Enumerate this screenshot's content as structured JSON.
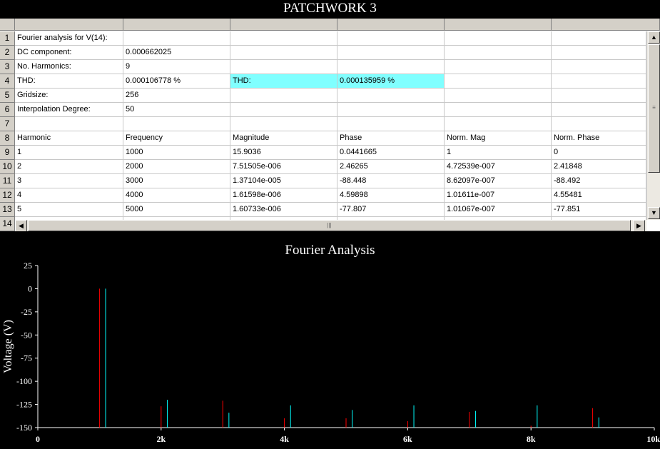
{
  "page_title": "PATCHWORK 3",
  "spreadsheet": {
    "row_numbers": [
      "1",
      "2",
      "3",
      "4",
      "5",
      "6",
      "7",
      "8",
      "9",
      "10",
      "11",
      "12",
      "13",
      "14"
    ],
    "rows": [
      [
        "Fourier analysis for V(14):",
        "",
        "",
        "",
        "",
        ""
      ],
      [
        "DC component:",
        "0.000662025",
        "",
        "",
        "",
        ""
      ],
      [
        "No. Harmonics:",
        "9",
        "",
        "",
        "",
        ""
      ],
      [
        "THD:",
        "0.000106778 %",
        "THD:",
        "0.000135959 %",
        "",
        ""
      ],
      [
        "Gridsize:",
        "256",
        "",
        "",
        "",
        ""
      ],
      [
        "Interpolation Degree:",
        "50",
        "",
        "",
        "",
        ""
      ],
      [
        "",
        "",
        "",
        "",
        "",
        ""
      ],
      [
        "Harmonic",
        "Frequency",
        "Magnitude",
        "Phase",
        "Norm. Mag",
        "Norm. Phase"
      ],
      [
        "1",
        "1000",
        "15.9036",
        "0.0441665",
        "1",
        "0"
      ],
      [
        "2",
        "2000",
        "7.51505e-006",
        "2.46265",
        "4.72539e-007",
        "2.41848"
      ],
      [
        "3",
        "3000",
        "1.37104e-005",
        "-88.448",
        "8.62097e-007",
        "-88.492"
      ],
      [
        "4",
        "4000",
        "1.61598e-006",
        "4.59898",
        "1.01611e-007",
        "4.55481"
      ],
      [
        "5",
        "5000",
        "1.60733e-006",
        "-77.807",
        "1.01067e-007",
        "-77.851"
      ]
    ],
    "highlight_color": "#80ffff",
    "scroll_icons": {
      "up": "▲",
      "down": "▼",
      "left": "◀",
      "right": "▶",
      "grip_v": "≡",
      "grip_h": "|||"
    }
  },
  "chart_title": "Fourier Analysis",
  "chart_data": {
    "type": "bar",
    "title": "Fourier Analysis",
    "xlabel": "",
    "ylabel": "Voltage (V)",
    "ylim": [
      -150,
      25
    ],
    "xlim": [
      0,
      10000
    ],
    "y_ticks": [
      "25",
      "0",
      "-25",
      "-50",
      "-75",
      "-100",
      "-125",
      "-150"
    ],
    "y_tick_values": [
      25,
      0,
      -25,
      -50,
      -75,
      -100,
      -125,
      -150
    ],
    "x_ticks": [
      "0",
      "2k",
      "4k",
      "6k",
      "8k",
      "10k"
    ],
    "x_tick_values": [
      0,
      2000,
      4000,
      6000,
      8000,
      10000
    ],
    "series": [
      {
        "color": "#ff0000",
        "x": [
          1000,
          2000,
          3000,
          4000,
          5000,
          6000,
          7000,
          8000,
          9000
        ],
        "values": [
          0,
          -127,
          -121,
          -140,
          -140,
          -143,
          -133,
          -148,
          -129
        ]
      },
      {
        "color": "#00ffff",
        "x": [
          1100,
          2100,
          3100,
          4100,
          5100,
          6100,
          7100,
          8100,
          9100
        ],
        "values": [
          0,
          -120,
          -134,
          -126,
          -131,
          -126,
          -132,
          -126,
          -139
        ]
      }
    ]
  }
}
